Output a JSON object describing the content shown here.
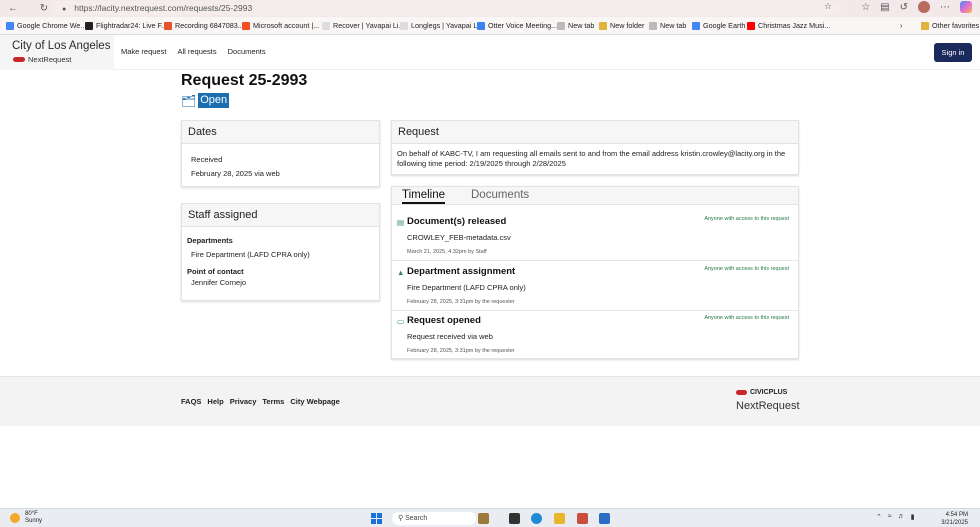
{
  "browser": {
    "url": "https://lacity.nextrequest.com/requests/25-2993",
    "bookmarks": [
      {
        "label": "Google Chrome We...",
        "color": "#4285f4"
      },
      {
        "label": "Flightradar24: Live F...",
        "color": "#222222"
      },
      {
        "label": "Recording 6847083...",
        "color": "#e8512b"
      },
      {
        "label": "Microsoft account |...",
        "color": "#f25022"
      },
      {
        "label": "Recover | Yavapai Li...",
        "color": "#dddddd"
      },
      {
        "label": "Longlegs | Yavapai L...",
        "color": "#dddddd"
      },
      {
        "label": "Otter Voice Meeting...",
        "color": "#3b82f6"
      },
      {
        "label": "New tab",
        "color": "#bbbbbb"
      },
      {
        "label": "New folder",
        "color": "#e0b33c"
      },
      {
        "label": "New tab",
        "color": "#bbbbbb"
      },
      {
        "label": "Google Earth",
        "color": "#4285f4"
      },
      {
        "label": "Christmas Jazz Musi...",
        "color": "#ff0000"
      }
    ],
    "other_favorites": "Other favorites"
  },
  "header": {
    "brand_title": "City of Los Angeles",
    "brand_sub": "NextRequest",
    "nav": [
      "Make request",
      "All requests",
      "Documents"
    ],
    "signin": "Sign in"
  },
  "request": {
    "title": "Request 25-2993",
    "status": "Open"
  },
  "dates": {
    "heading": "Dates",
    "received_label": "Received",
    "received_value": "February 28, 2025 via web"
  },
  "staff": {
    "heading": "Staff assigned",
    "departments_label": "Departments",
    "departments_value": "Fire Department (LAFD CPRA only)",
    "poc_label": "Point of contact",
    "poc_value": "Jennifer Cornejo"
  },
  "request_card": {
    "heading": "Request",
    "body": "On behalf of KABC-TV, I am requesting all emails sent to and from the email address kristin.crowley@lacity.org in the following time period: 2/19/2025 through 2/28/2025"
  },
  "timeline": {
    "tabs": [
      "Timeline",
      "Documents"
    ],
    "items": [
      {
        "title": "Document(s) released",
        "desc": "CROWLEY_FEB-metadata.csv",
        "meta": "March 21, 2025, 4:32pm by Staff",
        "visibility": "Anyone with access to this request",
        "icon": "document-icon"
      },
      {
        "title": "Department assignment",
        "desc": "Fire Department (LAFD CPRA only)",
        "meta": "February 28, 2025, 3:31pm by the requester",
        "visibility": "Anyone with access to this request",
        "icon": "building-icon"
      },
      {
        "title": "Request opened",
        "desc": "Request received via web",
        "meta": "February 28, 2025, 3:31pm by the requester",
        "visibility": "Anyone with access to this request",
        "icon": "folder-icon"
      }
    ]
  },
  "footer": {
    "links": [
      "FAQS",
      "Help",
      "Privacy",
      "Terms",
      "City Webpage"
    ],
    "civicplus": "CIVICPLUS",
    "nextrequest": "NextRequest"
  },
  "taskbar": {
    "temp": "80°F",
    "condition": "Sunny",
    "search": "Search",
    "time": "4:54 PM",
    "date": "3/21/2025"
  }
}
